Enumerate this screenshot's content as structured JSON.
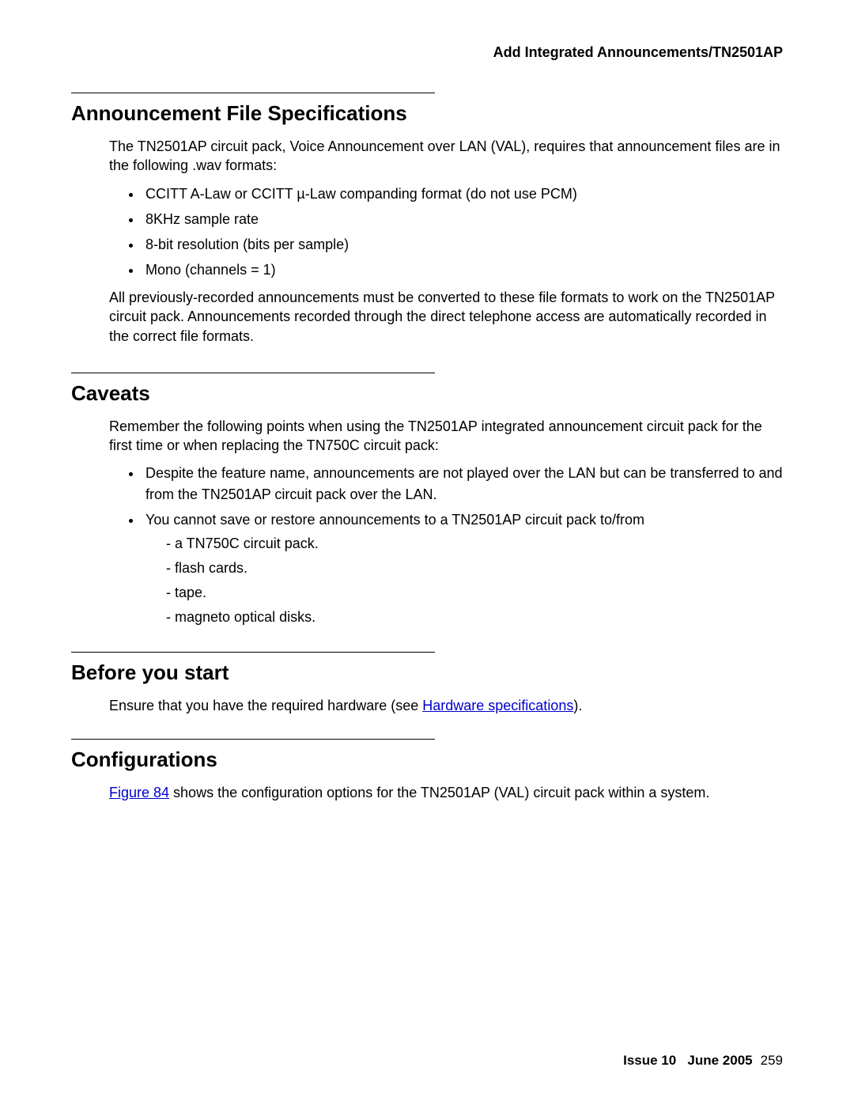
{
  "header": {
    "title": "Add Integrated Announcements/TN2501AP"
  },
  "section1": {
    "heading": "Announcement File Specifications",
    "intro": "The TN2501AP circuit pack, Voice Announcement over LAN (VAL), requires that announcement files are in the following .wav formats:",
    "bullets": [
      "CCITT A-Law or CCITT µ-Law companding format (do not use PCM)",
      "8KHz sample rate",
      "8-bit resolution (bits per sample)",
      "Mono (channels = 1)"
    ],
    "outro": "All previously-recorded announcements must be converted to these file formats to work on the TN2501AP circuit pack. Announcements recorded through the direct telephone access are automatically recorded in the correct file formats."
  },
  "section2": {
    "heading": "Caveats",
    "intro": "Remember the following points when using the TN2501AP integrated announcement circuit pack for the first time or when replacing the TN750C circuit pack:",
    "bullet1": "Despite the feature name, announcements are not played over the LAN but can be transferred to and from the TN2501AP circuit pack over the LAN.",
    "bullet2": "You cannot save or restore announcements to a TN2501AP circuit pack to/from",
    "sub": [
      "a TN750C circuit pack.",
      "flash cards.",
      "tape.",
      "magneto optical disks."
    ]
  },
  "section3": {
    "heading": "Before you start",
    "text_before": "Ensure that you have the required hardware (see ",
    "link": "Hardware specifications",
    "text_after": ")."
  },
  "section4": {
    "heading": "Configurations",
    "link": "Figure 84",
    "text_after": " shows the configuration options for the TN2501AP (VAL) circuit pack within a system."
  },
  "footer": {
    "issue": "Issue 10",
    "date": "June 2005",
    "page": "259"
  }
}
